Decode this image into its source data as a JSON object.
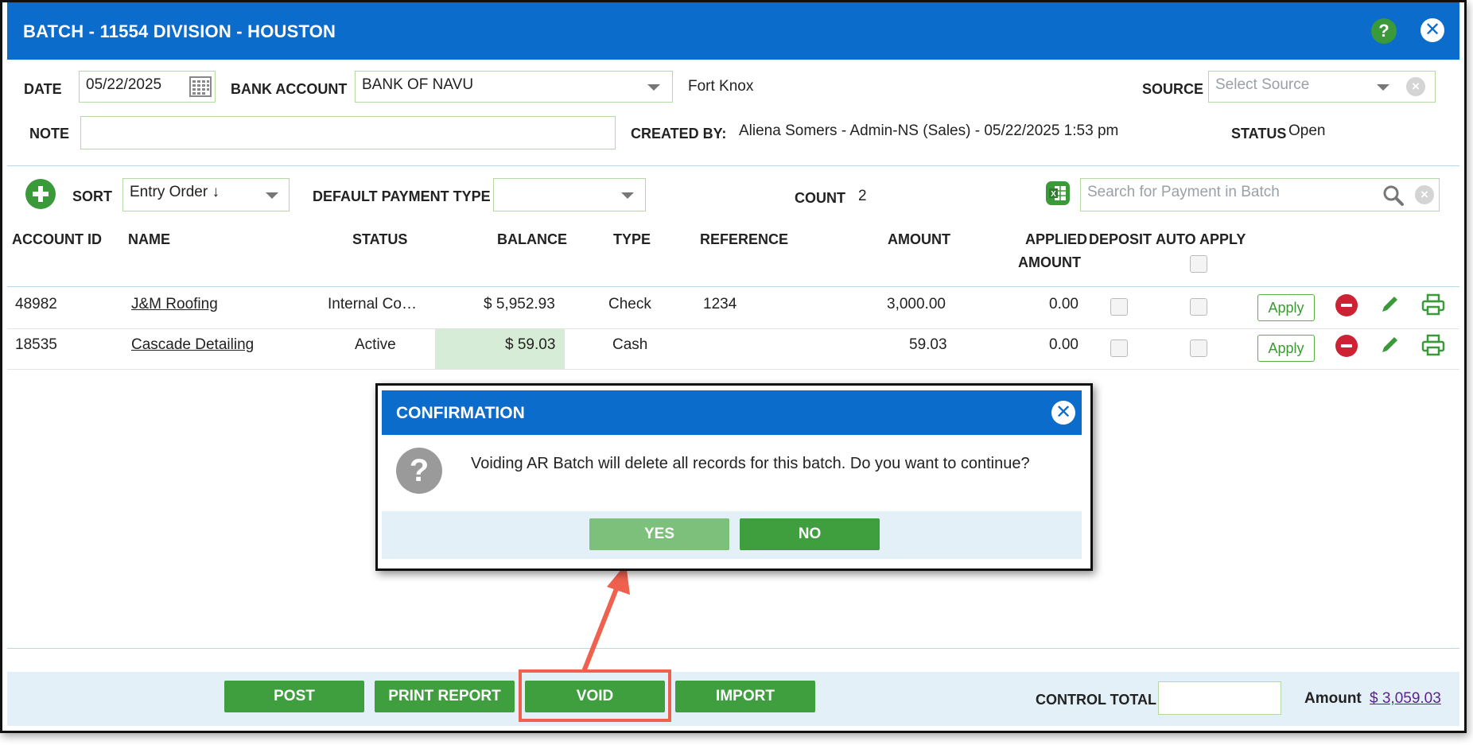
{
  "window": {
    "title": "BATCH - 11554 DIVISION - HOUSTON",
    "help_glyph": "?",
    "close_glyph": "✕"
  },
  "form": {
    "date_label": "DATE",
    "date_value": "05/22/2025",
    "bank_label": "BANK ACCOUNT",
    "bank_value": "BANK OF NAVU",
    "bank_note": "Fort Knox",
    "source_label": "SOURCE",
    "source_placeholder": "Select Source",
    "note_label": "NOTE",
    "note_value": "",
    "created_by_label": "CREATED BY:",
    "created_by_value": "Aliena Somers - Admin-NS (Sales) - 05/22/2025 1:53 pm",
    "status_label": "STATUS",
    "status_value": "Open"
  },
  "toolbar": {
    "sort_label": "SORT",
    "sort_value": "Entry Order ↓",
    "default_payment_label": "DEFAULT PAYMENT TYPE",
    "default_payment_value": "",
    "count_label": "COUNT",
    "count_value": "2",
    "search_placeholder": "Search for Payment in Batch"
  },
  "table": {
    "headers": {
      "account_id": "ACCOUNT ID",
      "name": "NAME",
      "status": "STATUS",
      "balance": "BALANCE",
      "type": "TYPE",
      "reference": "REFERENCE",
      "amount": "AMOUNT",
      "applied_1": "APPLIED",
      "applied_2": "AMOUNT",
      "deposit": "DEPOSIT",
      "auto_apply": "AUTO APPLY"
    },
    "rows": [
      {
        "account_id": "48982",
        "name": "J&M Roofing",
        "status": "Internal Co…",
        "balance": "$ 5,952.93",
        "type": "Check",
        "reference": "1234",
        "amount": "3,000.00",
        "applied": "0.00",
        "apply_label": "Apply"
      },
      {
        "account_id": "18535",
        "name": "Cascade Detailing",
        "status": "Active",
        "balance": "$ 59.03",
        "type": "Cash",
        "reference": "",
        "amount": "59.03",
        "applied": "0.00",
        "apply_label": "Apply"
      }
    ]
  },
  "dialog": {
    "title": "CONFIRMATION",
    "message": "Voiding AR Batch will delete all records for this batch. Do you want to continue?",
    "yes_label": "YES",
    "no_label": "NO",
    "question_glyph": "?"
  },
  "footer": {
    "post_label": "POST",
    "print_label": "PRINT REPORT",
    "void_label": "VOID",
    "import_label": "IMPORT",
    "control_total_label": "CONTROL TOTAL",
    "control_total_value": "",
    "amount_label": "Amount",
    "amount_value": "$ 3,059.03"
  },
  "colors": {
    "header_blue": "#0c6ccc",
    "button_green": "#3f9f3f",
    "yes_green_light": "#7cc07c",
    "highlight_red": "#f0604f",
    "remove_red": "#cc2233",
    "balance_highlight": "#d6ecd6"
  },
  "icons": [
    "help-icon",
    "close-icon",
    "calendar-icon",
    "chevron-down-icon",
    "clear-icon",
    "add-icon",
    "excel-icon",
    "search-icon",
    "remove-icon",
    "edit-icon",
    "print-icon",
    "question-icon",
    "annotation-arrow"
  ]
}
